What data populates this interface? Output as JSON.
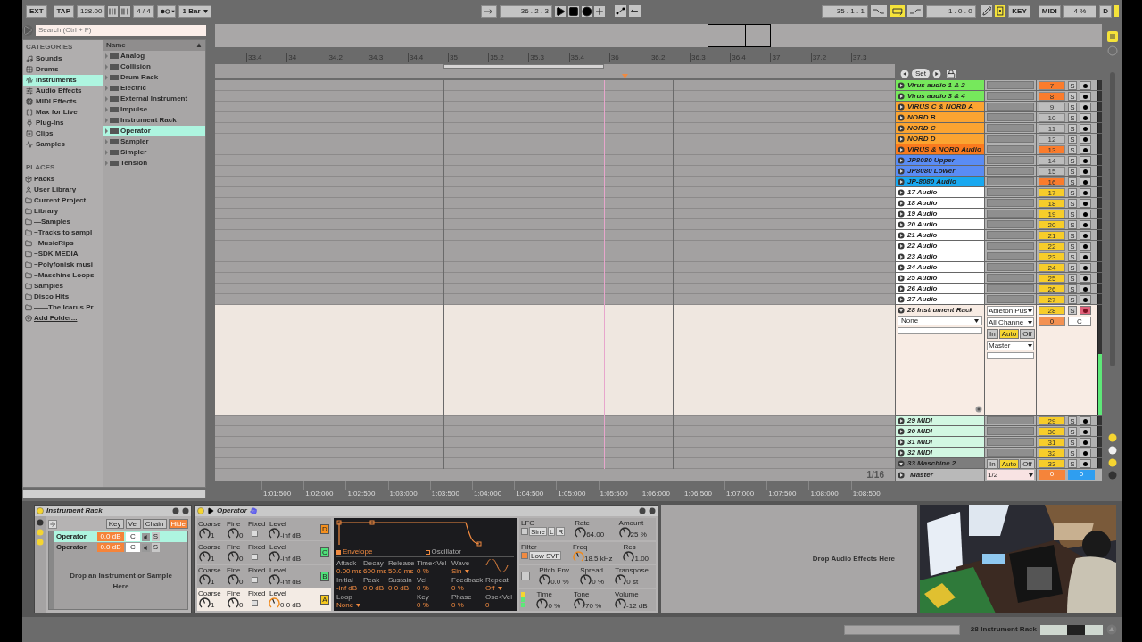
{
  "transport": {
    "ext": "EXT",
    "tap": "TAP",
    "tempo": "128.00",
    "signature": "4 / 4",
    "quantize": "1 Bar",
    "position": "36 . 2 . 3",
    "loop_start": "35 . 1 . 1",
    "loop_on": true,
    "loop_length": "1 . 0 . 0",
    "key_map_on": true,
    "key": "KEY",
    "midi": "MIDI",
    "cpu": "4 %",
    "d": "D"
  },
  "browser": {
    "search": {
      "placeholder": "Search (Ctrl + F)"
    },
    "categories_title": "CATEGORIES",
    "categories": [
      {
        "label": "Sounds",
        "selected": false
      },
      {
        "label": "Drums",
        "selected": false
      },
      {
        "label": "Instruments",
        "selected": true
      },
      {
        "label": "Audio Effects",
        "selected": false
      },
      {
        "label": "MIDI Effects",
        "selected": false
      },
      {
        "label": "Max for Live",
        "selected": false
      },
      {
        "label": "Plug-Ins",
        "selected": false
      },
      {
        "label": "Clips",
        "selected": false
      },
      {
        "label": "Samples",
        "selected": false
      }
    ],
    "places_title": "PLACES",
    "places": [
      {
        "label": "Packs",
        "kind": "packs"
      },
      {
        "label": "User Library",
        "kind": "user"
      },
      {
        "label": "Current Project",
        "kind": "folder"
      },
      {
        "label": "Library",
        "kind": "folder"
      },
      {
        "label": "—Samples",
        "kind": "folder"
      },
      {
        "label": "~Tracks to sampl",
        "kind": "folder"
      },
      {
        "label": "~MusicRips",
        "kind": "folder"
      },
      {
        "label": "~SDK MEDIA",
        "kind": "folder"
      },
      {
        "label": "~Polyfonisk musi",
        "kind": "folder"
      },
      {
        "label": "~Maschine Loops",
        "kind": "folder"
      },
      {
        "label": "Samples",
        "kind": "folder"
      },
      {
        "label": "Disco Hits",
        "kind": "folder"
      },
      {
        "label": "——The Icarus Pr",
        "kind": "folder"
      },
      {
        "label": "Add Folder...",
        "kind": "add"
      }
    ],
    "name_header": "Name",
    "name_sort": "▲",
    "items": [
      {
        "label": "Analog",
        "selected": false
      },
      {
        "label": "Collision",
        "selected": false
      },
      {
        "label": "Drum Rack",
        "selected": false
      },
      {
        "label": "Electric",
        "selected": false
      },
      {
        "label": "External Instrument",
        "selected": false
      },
      {
        "label": "Impulse",
        "selected": false
      },
      {
        "label": "Instrument Rack",
        "selected": false
      },
      {
        "label": "Operator",
        "selected": true
      },
      {
        "label": "Sampler",
        "selected": false
      },
      {
        "label": "Simpler",
        "selected": false
      },
      {
        "label": "Tension",
        "selected": false
      }
    ]
  },
  "ruler": {
    "bars": [
      "33.4",
      "34",
      "34.2",
      "34.3",
      "34.4",
      "35",
      "35.2",
      "35.3",
      "35.4",
      "36",
      "36.2",
      "36.3",
      "36.4",
      "37",
      "37.2",
      "37.3"
    ],
    "time": [
      "1:01:500",
      "1:02:000",
      "1:02:500",
      "1:03:000",
      "1:03:500",
      "1:04:000",
      "1:04:500",
      "1:05:000",
      "1:05:500",
      "1:06:000",
      "1:06:500",
      "1:07:000",
      "1:07:500",
      "1:08:000",
      "1:08:500"
    ],
    "set": "Set",
    "zoom": "1/16"
  },
  "tracks": [
    {
      "kind": "audio",
      "name": "Virus audio 1 & 2",
      "color": "#76e85c",
      "activator": {
        "label": "7",
        "color": "#fb7c2c"
      },
      "solo": "S",
      "armed": false,
      "expanded": false
    },
    {
      "kind": "audio",
      "name": "Virus audio 3 & 4",
      "color": "#76e85c",
      "activator": {
        "label": "8",
        "color": "#fb7c2c"
      },
      "solo": "S",
      "armed": false,
      "expanded": false
    },
    {
      "kind": "midi",
      "name": "VIRUS C & NORD A",
      "color": "#fba431",
      "activator": {
        "label": "9",
        "color": "#bdbdbd"
      },
      "solo": "S",
      "armed": false,
      "expanded": false
    },
    {
      "kind": "midi",
      "name": "NORD B",
      "color": "#fba431",
      "activator": {
        "label": "10",
        "color": "#bdbdbd"
      },
      "solo": "S",
      "armed": false,
      "expanded": false
    },
    {
      "kind": "midi",
      "name": "NORD C",
      "color": "#fba431",
      "activator": {
        "label": "11",
        "color": "#bdbdbd"
      },
      "solo": "S",
      "armed": false,
      "expanded": false
    },
    {
      "kind": "midi",
      "name": "NORD D",
      "color": "#fba431",
      "activator": {
        "label": "12",
        "color": "#bdbdbd"
      },
      "solo": "S",
      "armed": false,
      "expanded": false
    },
    {
      "kind": "audio",
      "name": "VIRUS & NORD Audio",
      "color": "#fa7a1e",
      "activator": {
        "label": "13",
        "color": "#fb7c2c"
      },
      "solo": "S",
      "armed": false,
      "expanded": false
    },
    {
      "kind": "midi",
      "name": "JP8080 Upper",
      "color": "#5a8cf5",
      "activator": {
        "label": "14",
        "color": "#bdbdbd"
      },
      "solo": "S",
      "armed": false,
      "expanded": false
    },
    {
      "kind": "midi",
      "name": "JP8080 Lower",
      "color": "#5a8cf5",
      "activator": {
        "label": "15",
        "color": "#bdbdbd"
      },
      "solo": "S",
      "armed": false,
      "expanded": false
    },
    {
      "kind": "audio",
      "name": "JP-8080 Audio",
      "color": "#19a8f0",
      "activator": {
        "label": "16",
        "color": "#fb7c2c"
      },
      "solo": "S",
      "armed": false,
      "expanded": false
    },
    {
      "kind": "audio",
      "name": "17 Audio",
      "color": "#ffffff",
      "activator": {
        "label": "17",
        "color": "#f7cd2a"
      },
      "solo": "S",
      "armed": false,
      "expanded": false
    },
    {
      "kind": "audio",
      "name": "18 Audio",
      "color": "#ffffff",
      "activator": {
        "label": "18",
        "color": "#f7cd2a"
      },
      "solo": "S",
      "armed": false,
      "expanded": false
    },
    {
      "kind": "audio",
      "name": "19 Audio",
      "color": "#ffffff",
      "activator": {
        "label": "19",
        "color": "#f7cd2a"
      },
      "solo": "S",
      "armed": false,
      "expanded": false
    },
    {
      "kind": "audio",
      "name": "20 Audio",
      "color": "#ffffff",
      "activator": {
        "label": "20",
        "color": "#f7cd2a"
      },
      "solo": "S",
      "armed": false,
      "expanded": false
    },
    {
      "kind": "audio",
      "name": "21 Audio",
      "color": "#ffffff",
      "activator": {
        "label": "21",
        "color": "#f7cd2a"
      },
      "solo": "S",
      "armed": false,
      "expanded": false
    },
    {
      "kind": "audio",
      "name": "22 Audio",
      "color": "#ffffff",
      "activator": {
        "label": "22",
        "color": "#f7cd2a"
      },
      "solo": "S",
      "armed": false,
      "expanded": false
    },
    {
      "kind": "audio",
      "name": "23 Audio",
      "color": "#ffffff",
      "activator": {
        "label": "23",
        "color": "#f7cd2a"
      },
      "solo": "S",
      "armed": false,
      "expanded": false
    },
    {
      "kind": "audio",
      "name": "24 Audio",
      "color": "#ffffff",
      "activator": {
        "label": "24",
        "color": "#f7cd2a"
      },
      "solo": "S",
      "armed": false,
      "expanded": false
    },
    {
      "kind": "audio",
      "name": "25 Audio",
      "color": "#ffffff",
      "activator": {
        "label": "25",
        "color": "#f7cd2a"
      },
      "solo": "S",
      "armed": false,
      "expanded": false
    },
    {
      "kind": "audio",
      "name": "26 Audio",
      "color": "#ffffff",
      "activator": {
        "label": "26",
        "color": "#f7cd2a"
      },
      "solo": "S",
      "armed": false,
      "expanded": false
    },
    {
      "kind": "audio",
      "name": "27 Audio",
      "color": "#ffffff",
      "activator": {
        "label": "27",
        "color": "#f7cd2a"
      },
      "solo": "S",
      "armed": false,
      "expanded": false
    },
    {
      "kind": "rack",
      "name": "28 Instrument Rack",
      "color": "#f8ece4",
      "activator": {
        "label": "28",
        "color": "#f7cd2a"
      },
      "solo": "S",
      "armed": true,
      "expanded": true,
      "chain": "None",
      "input": "Ableton Pus",
      "channel": "All Channe",
      "monitor": [
        {
          "label": "In",
          "selected": false
        },
        {
          "label": "Auto",
          "selected": true
        },
        {
          "label": "Off",
          "selected": false
        }
      ],
      "output": "Master",
      "volume": "0",
      "pan": "C",
      "level": 0.55
    },
    {
      "kind": "midi",
      "name": "29 MIDI",
      "color": "#d2f7e2",
      "activator": {
        "label": "29",
        "color": "#f7cd2a"
      },
      "solo": "S",
      "armed": false,
      "expanded": false
    },
    {
      "kind": "midi",
      "name": "30 MIDI",
      "color": "#d2f7e2",
      "activator": {
        "label": "30",
        "color": "#f7cd2a"
      },
      "solo": "S",
      "armed": false,
      "expanded": false
    },
    {
      "kind": "midi",
      "name": "31 MIDI",
      "color": "#d2f7e2",
      "activator": {
        "label": "31",
        "color": "#f7cd2a"
      },
      "solo": "S",
      "armed": false,
      "expanded": false
    },
    {
      "kind": "midi",
      "name": "32 MIDI",
      "color": "#d2f7e2",
      "activator": {
        "label": "32",
        "color": "#f7cd2a"
      },
      "solo": "S",
      "armed": false,
      "expanded": false
    },
    {
      "kind": "audio",
      "name": "33 Maschine 2",
      "color": "#7d7d7d",
      "activator": {
        "label": "33",
        "color": "#f7cd2a"
      },
      "solo": "S",
      "armed": false,
      "expanded": true,
      "monitor": [
        {
          "label": "In",
          "selected": false
        },
        {
          "label": "Auto",
          "selected": true
        },
        {
          "label": "Off",
          "selected": false
        }
      ]
    }
  ],
  "master": {
    "name": "Master",
    "output": "1/2",
    "volume": "0",
    "pan": "0"
  },
  "rack": {
    "title": "Instrument Rack",
    "buttons": [
      {
        "label": "Key",
        "selected": false
      },
      {
        "label": "Vel",
        "selected": false
      },
      {
        "label": "Chain",
        "selected": false
      },
      {
        "label": "Hide",
        "selected": true
      }
    ],
    "chains": [
      {
        "name": "Operator",
        "volume": "0.0 dB",
        "pan": "C",
        "solo": "S",
        "selected": true
      },
      {
        "name": "Operator",
        "volume": "0.0 dB",
        "pan": "C",
        "solo": "S",
        "selected": false
      }
    ],
    "drop": "Drop an Instrument or Sample Here"
  },
  "operator": {
    "title": "Operator",
    "oscillators": [
      {
        "letter": "D",
        "color": "#f5901e",
        "labels": [
          "Coarse",
          "Fine",
          "Fixed",
          "Level"
        ],
        "coarse": "1",
        "fine": "0",
        "level_text": "-inf dB",
        "selected": false
      },
      {
        "letter": "C",
        "color": "#4fe07a",
        "labels": [
          "Coarse",
          "Fine",
          "Fixed",
          "Level"
        ],
        "coarse": "1",
        "fine": "0",
        "level_text": "-inf dB",
        "selected": false
      },
      {
        "letter": "B",
        "color": "#4fe07a",
        "labels": [
          "Coarse",
          "Fine",
          "Fixed",
          "Level"
        ],
        "coarse": "1",
        "fine": "0",
        "level_text": "-inf dB",
        "selected": false
      },
      {
        "letter": "A",
        "color": "#f5c81e",
        "labels": [
          "Coarse",
          "Fine",
          "Fixed",
          "Level"
        ],
        "coarse": "1",
        "fine": "0",
        "level_text": "0.0 dB",
        "selected": true
      }
    ],
    "tabs": [
      {
        "label": "Envelope",
        "selected": true
      },
      {
        "label": "Oscillator",
        "selected": false
      }
    ],
    "env": [
      [
        {
          "label": "Attack",
          "value": "0.00 ms"
        },
        {
          "label": "Decay",
          "value": "600 ms"
        },
        {
          "label": "Release",
          "value": "50.0 ms"
        },
        {
          "label": "Time<Vel",
          "value": "0 %"
        }
      ],
      [
        {
          "label": "Initial",
          "value": "-inf dB"
        },
        {
          "label": "Peak",
          "value": "0.0 dB"
        },
        {
          "label": "Sustain",
          "value": "0.0 dB"
        },
        {
          "label": "Vel",
          "value": "0 %"
        }
      ],
      [
        {
          "label": "Loop",
          "value": "None",
          "kind": "menu"
        },
        {
          "label": "Key",
          "value": "0 %"
        }
      ]
    ],
    "osc": [
      [
        {
          "label": "Wave",
          "value": "Sin",
          "kind": "menu"
        }
      ],
      [
        {
          "label": "Feedback",
          "value": "0 %"
        },
        {
          "label": "Repeat",
          "value": "Off",
          "kind": "menu"
        }
      ],
      [
        {
          "label": "Phase",
          "value": "0 %"
        },
        {
          "label": "Osc<Vel",
          "value": "0"
        }
      ]
    ],
    "sections": [
      {
        "kind": "lfo",
        "title": "LFO",
        "controls": [
          "Sine",
          "L",
          "R"
        ],
        "on": false,
        "knobs": [
          {
            "label": "Rate",
            "value": "64.00"
          },
          {
            "label": "Amount",
            "value": "25 %"
          }
        ]
      },
      {
        "kind": "filter",
        "title": "Filter",
        "controls": [
          "Low SVF"
        ],
        "on": true,
        "knobs": [
          {
            "label": "Freq",
            "value": "18.5 kHz"
          },
          {
            "label": "Res",
            "value": "1.00"
          }
        ]
      },
      {
        "kind": "pitch",
        "on": false,
        "knobs": [
          {
            "label": "Pitch Env",
            "value": "0.0 %"
          },
          {
            "label": "Spread",
            "value": "0 %"
          },
          {
            "label": "Transpose",
            "value": "0 st"
          }
        ]
      },
      {
        "kind": "global",
        "knobs": [
          {
            "label": "Time",
            "value": "0 %"
          },
          {
            "label": "Tone",
            "value": "70 %"
          },
          {
            "label": "Volume",
            "value": "-12 dB"
          }
        ]
      }
    ]
  },
  "effects_drop": "Drop Audio Effects Here",
  "status": "28-Instrument Rack"
}
